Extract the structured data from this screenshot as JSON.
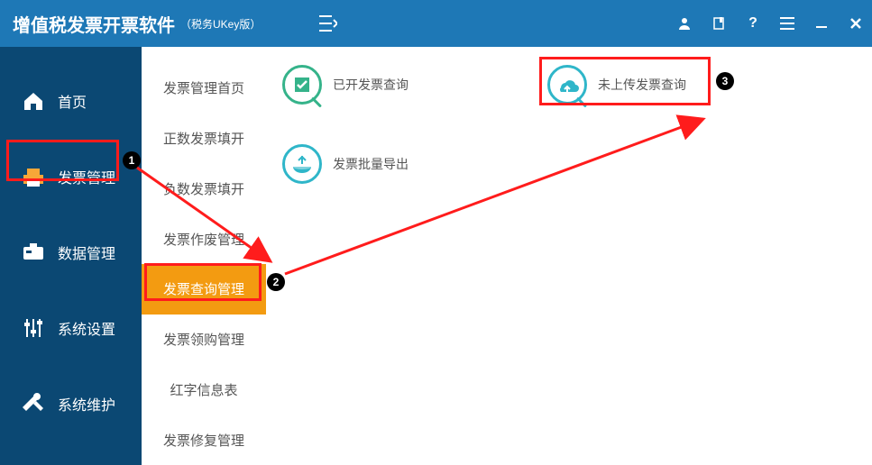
{
  "colors": {
    "primary": "#1e78b6",
    "sidebar": "#0b4873",
    "accent": "#f39b11",
    "highlight": "#ff1c1c"
  },
  "titlebar": {
    "app_name": "增值税发票开票软件",
    "edition": "（税务UKey版）"
  },
  "sidebar": {
    "items": [
      {
        "label": "首页"
      },
      {
        "label": "发票管理"
      },
      {
        "label": "数据管理"
      },
      {
        "label": "系统设置"
      },
      {
        "label": "系统维护"
      }
    ],
    "active_index": 1
  },
  "submenu": {
    "items": [
      {
        "label": "发票管理首页"
      },
      {
        "label": "正数发票填开"
      },
      {
        "label": "负数发票填开"
      },
      {
        "label": "发票作废管理"
      },
      {
        "label": "发票查询管理"
      },
      {
        "label": "发票领购管理"
      },
      {
        "label": "红字信息表"
      },
      {
        "label": "发票修复管理"
      }
    ],
    "active_index": 4
  },
  "main": {
    "tiles": [
      {
        "label": "已开发票查询"
      },
      {
        "label": "未上传发票查询"
      },
      {
        "label": "发票批量导出"
      }
    ]
  },
  "annotations": {
    "badges": [
      "1",
      "2",
      "3"
    ]
  }
}
